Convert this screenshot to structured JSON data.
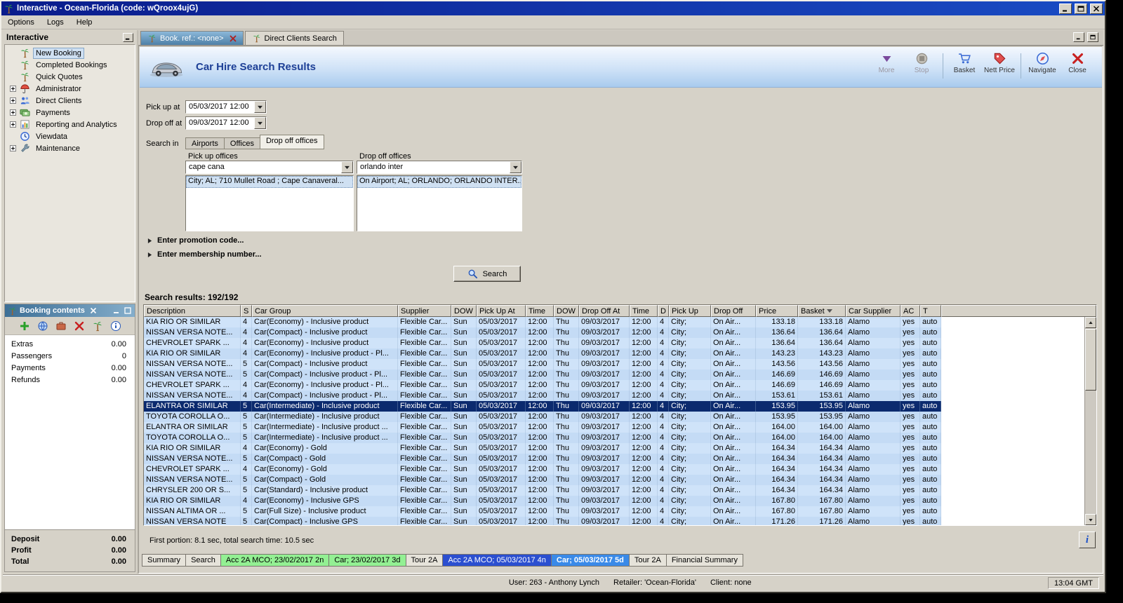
{
  "window": {
    "title": "Interactive - Ocean-Florida (code: wQroox4ujG)",
    "clock": "13:04 GMT",
    "status": {
      "user": "User: 263 - Anthony Lynch",
      "retailer": "Retailer: 'Ocean-Florida'",
      "client": "Client: none"
    }
  },
  "menu": {
    "items": [
      "Options",
      "Logs",
      "Help"
    ]
  },
  "sidebar": {
    "title": "Interactive",
    "items": [
      {
        "label": "New Booking",
        "icon": "palm-icon",
        "expandable": false,
        "selected": true
      },
      {
        "label": "Completed Bookings",
        "icon": "palm-icon",
        "expandable": false,
        "selected": false
      },
      {
        "label": "Quick Quotes",
        "icon": "palm-icon",
        "expandable": false,
        "selected": false
      },
      {
        "label": "Administrator",
        "icon": "umbrella-icon",
        "expandable": true,
        "selected": false
      },
      {
        "label": "Direct Clients",
        "icon": "clients-icon",
        "expandable": true,
        "selected": false
      },
      {
        "label": "Payments",
        "icon": "payments-icon",
        "expandable": true,
        "selected": false
      },
      {
        "label": "Reporting and Analytics",
        "icon": "report-icon",
        "expandable": true,
        "selected": false
      },
      {
        "label": "Viewdata",
        "icon": "clock-icon",
        "expandable": false,
        "selected": false
      },
      {
        "label": "Maintenance",
        "icon": "wrench-icon",
        "expandable": true,
        "selected": false
      }
    ]
  },
  "booking_contents": {
    "title": "Booking contents",
    "toolbar_icons": [
      "add-icon",
      "world-icon",
      "luggage-icon",
      "delete-icon",
      "palm-icon",
      "info-icon"
    ],
    "rows": [
      {
        "label": "Extras",
        "value": "0.00"
      },
      {
        "label": "Passengers",
        "value": "0"
      },
      {
        "label": "Payments",
        "value": "0.00"
      },
      {
        "label": "Refunds",
        "value": "0.00"
      }
    ],
    "totals": [
      {
        "label": "Deposit",
        "value": "0.00"
      },
      {
        "label": "Profit",
        "value": "0.00"
      },
      {
        "label": "Total",
        "value": "0.00"
      }
    ]
  },
  "mdi_tabs": [
    {
      "label": "Book. ref.: <none>",
      "icon": "palm-icon",
      "closable": true,
      "active": true
    },
    {
      "label": "Direct Clients Search",
      "icon": "palm-icon",
      "closable": false,
      "active": false
    }
  ],
  "page": {
    "title": "Car Hire Search Results",
    "icon": "car-icon",
    "toolbar": [
      {
        "label": "More",
        "icon": "more-icon",
        "disabled": true,
        "sep_after": false
      },
      {
        "label": "Stop",
        "icon": "stop-icon",
        "disabled": true,
        "sep_after": true
      },
      {
        "label": "Basket",
        "icon": "basket-icon",
        "disabled": false,
        "sep_after": false
      },
      {
        "label": "Nett Price",
        "icon": "nett-price-icon",
        "disabled": false,
        "sep_after": true
      },
      {
        "label": "Navigate",
        "icon": "navigate-icon",
        "disabled": false,
        "sep_after": false
      },
      {
        "label": "Close",
        "icon": "close-icon",
        "disabled": false,
        "sep_after": false
      }
    ]
  },
  "form": {
    "pickup_label": "Pick up at",
    "pickup_value": "05/03/2017 12:00",
    "dropoff_label": "Drop off at",
    "dropoff_value": "09/03/2017 12:00",
    "search_in_label": "Search in",
    "search_tabs": [
      "Airports",
      "Offices",
      "Drop off offices"
    ],
    "active_search_tab": 2,
    "pickup_offices_label": "Pick up offices",
    "pickup_offices_value": "cape cana",
    "pickup_offices_item": "City; AL; 710 Mullet Road ; Cape Canaveral...",
    "dropoff_offices_label": "Drop off offices",
    "dropoff_offices_value": "orlando inter",
    "dropoff_offices_item": "On Airport; AL; ORLANDO; ORLANDO INTER...",
    "promo_label": "Enter promotion code...",
    "membership_label": "Enter membership number...",
    "search_button": "Search"
  },
  "results": {
    "summary": "Search results: 192/192",
    "columns": [
      "Description",
      "S",
      "Car Group",
      "Supplier",
      "DOW",
      "Pick Up At",
      "Time",
      "DOW",
      "Drop Off At",
      "Time",
      "D",
      "Pick Up",
      "Drop Off",
      "Price",
      "Basket",
      "Car Supplier",
      "AC",
      "T"
    ],
    "sort_column": "Basket",
    "selected_row": 8,
    "footer": "First portion: 8.1 sec, total search time: 10.5 sec",
    "rows": [
      [
        "KIA RIO OR SIMILAR",
        "4",
        "Car(Economy) - Inclusive product",
        "Flexible Car...",
        "Sun",
        "05/03/2017",
        "12:00",
        "Thu",
        "09/03/2017",
        "12:00",
        "4",
        "City;",
        "On Air...",
        "133.18",
        "133.18",
        "Alamo",
        "yes",
        "auto"
      ],
      [
        "NISSAN VERSA NOTE...",
        "4",
        "Car(Compact) - Inclusive product",
        "Flexible Car...",
        "Sun",
        "05/03/2017",
        "12:00",
        "Thu",
        "09/03/2017",
        "12:00",
        "4",
        "City;",
        "On Air...",
        "136.64",
        "136.64",
        "Alamo",
        "yes",
        "auto"
      ],
      [
        "CHEVROLET SPARK ...",
        "4",
        "Car(Economy) - Inclusive product",
        "Flexible Car...",
        "Sun",
        "05/03/2017",
        "12:00",
        "Thu",
        "09/03/2017",
        "12:00",
        "4",
        "City;",
        "On Air...",
        "136.64",
        "136.64",
        "Alamo",
        "yes",
        "auto"
      ],
      [
        "KIA RIO OR SIMILAR",
        "4",
        "Car(Economy) - Inclusive product - Pl...",
        "Flexible Car...",
        "Sun",
        "05/03/2017",
        "12:00",
        "Thu",
        "09/03/2017",
        "12:00",
        "4",
        "City;",
        "On Air...",
        "143.23",
        "143.23",
        "Alamo",
        "yes",
        "auto"
      ],
      [
        "NISSAN VERSA NOTE...",
        "5",
        "Car(Compact) - Inclusive product",
        "Flexible Car...",
        "Sun",
        "05/03/2017",
        "12:00",
        "Thu",
        "09/03/2017",
        "12:00",
        "4",
        "City;",
        "On Air...",
        "143.56",
        "143.56",
        "Alamo",
        "yes",
        "auto"
      ],
      [
        "NISSAN VERSA NOTE...",
        "5",
        "Car(Compact) - Inclusive product - Pl...",
        "Flexible Car...",
        "Sun",
        "05/03/2017",
        "12:00",
        "Thu",
        "09/03/2017",
        "12:00",
        "4",
        "City;",
        "On Air...",
        "146.69",
        "146.69",
        "Alamo",
        "yes",
        "auto"
      ],
      [
        "CHEVROLET SPARK ...",
        "4",
        "Car(Economy) - Inclusive product - Pl...",
        "Flexible Car...",
        "Sun",
        "05/03/2017",
        "12:00",
        "Thu",
        "09/03/2017",
        "12:00",
        "4",
        "City;",
        "On Air...",
        "146.69",
        "146.69",
        "Alamo",
        "yes",
        "auto"
      ],
      [
        "NISSAN VERSA NOTE...",
        "4",
        "Car(Compact) - Inclusive product - Pl...",
        "Flexible Car...",
        "Sun",
        "05/03/2017",
        "12:00",
        "Thu",
        "09/03/2017",
        "12:00",
        "4",
        "City;",
        "On Air...",
        "153.61",
        "153.61",
        "Alamo",
        "yes",
        "auto"
      ],
      [
        "ELANTRA OR SIMILAR",
        "5",
        "Car(Intermediate) - Inclusive product",
        "Flexible Car...",
        "Sun",
        "05/03/2017",
        "12:00",
        "Thu",
        "09/03/2017",
        "12:00",
        "4",
        "City;",
        "On Air...",
        "153.95",
        "153.95",
        "Alamo",
        "yes",
        "auto"
      ],
      [
        "TOYOTA COROLLA O...",
        "5",
        "Car(Intermediate) - Inclusive product",
        "Flexible Car...",
        "Sun",
        "05/03/2017",
        "12:00",
        "Thu",
        "09/03/2017",
        "12:00",
        "4",
        "City;",
        "On Air...",
        "153.95",
        "153.95",
        "Alamo",
        "yes",
        "auto"
      ],
      [
        "ELANTRA OR SIMILAR",
        "5",
        "Car(Intermediate) - Inclusive product ...",
        "Flexible Car...",
        "Sun",
        "05/03/2017",
        "12:00",
        "Thu",
        "09/03/2017",
        "12:00",
        "4",
        "City;",
        "On Air...",
        "164.00",
        "164.00",
        "Alamo",
        "yes",
        "auto"
      ],
      [
        "TOYOTA COROLLA O...",
        "5",
        "Car(Intermediate) - Inclusive product ...",
        "Flexible Car...",
        "Sun",
        "05/03/2017",
        "12:00",
        "Thu",
        "09/03/2017",
        "12:00",
        "4",
        "City;",
        "On Air...",
        "164.00",
        "164.00",
        "Alamo",
        "yes",
        "auto"
      ],
      [
        "KIA RIO OR SIMILAR",
        "4",
        "Car(Economy) - Gold",
        "Flexible Car...",
        "Sun",
        "05/03/2017",
        "12:00",
        "Thu",
        "09/03/2017",
        "12:00",
        "4",
        "City;",
        "On Air...",
        "164.34",
        "164.34",
        "Alamo",
        "yes",
        "auto"
      ],
      [
        "NISSAN VERSA NOTE...",
        "5",
        "Car(Compact) - Gold",
        "Flexible Car...",
        "Sun",
        "05/03/2017",
        "12:00",
        "Thu",
        "09/03/2017",
        "12:00",
        "4",
        "City;",
        "On Air...",
        "164.34",
        "164.34",
        "Alamo",
        "yes",
        "auto"
      ],
      [
        "CHEVROLET SPARK ...",
        "4",
        "Car(Economy) - Gold",
        "Flexible Car...",
        "Sun",
        "05/03/2017",
        "12:00",
        "Thu",
        "09/03/2017",
        "12:00",
        "4",
        "City;",
        "On Air...",
        "164.34",
        "164.34",
        "Alamo",
        "yes",
        "auto"
      ],
      [
        "NISSAN VERSA NOTE...",
        "5",
        "Car(Compact) - Gold",
        "Flexible Car...",
        "Sun",
        "05/03/2017",
        "12:00",
        "Thu",
        "09/03/2017",
        "12:00",
        "4",
        "City;",
        "On Air...",
        "164.34",
        "164.34",
        "Alamo",
        "yes",
        "auto"
      ],
      [
        "CHRYSLER 200 OR S...",
        "5",
        "Car(Standard) - Inclusive product",
        "Flexible Car...",
        "Sun",
        "05/03/2017",
        "12:00",
        "Thu",
        "09/03/2017",
        "12:00",
        "4",
        "City;",
        "On Air...",
        "164.34",
        "164.34",
        "Alamo",
        "yes",
        "auto"
      ],
      [
        "KIA RIO OR SIMILAR",
        "4",
        "Car(Economy) - Inclusive GPS",
        "Flexible Car...",
        "Sun",
        "05/03/2017",
        "12:00",
        "Thu",
        "09/03/2017",
        "12:00",
        "4",
        "City;",
        "On Air...",
        "167.80",
        "167.80",
        "Alamo",
        "yes",
        "auto"
      ],
      [
        "NISSAN ALTIMA OR ...",
        "5",
        "Car(Full Size) - Inclusive product",
        "Flexible Car...",
        "Sun",
        "05/03/2017",
        "12:00",
        "Thu",
        "09/03/2017",
        "12:00",
        "4",
        "City;",
        "On Air...",
        "167.80",
        "167.80",
        "Alamo",
        "yes",
        "auto"
      ],
      [
        "NISSAN VERSA NOTE",
        "5",
        "Car(Compact) - Inclusive GPS",
        "Flexible Car...",
        "Sun",
        "05/03/2017",
        "12:00",
        "Thu",
        "09/03/2017",
        "12:00",
        "4",
        "City;",
        "On Air...",
        "171.26",
        "171.26",
        "Alamo",
        "yes",
        "auto"
      ]
    ]
  },
  "bottom_tabs": [
    {
      "label": "Summary",
      "style": "plain",
      "active": false
    },
    {
      "label": "Search",
      "style": "plain",
      "active": false
    },
    {
      "label": "Acc 2A MCO; 23/02/2017 2n",
      "style": "green",
      "active": false
    },
    {
      "label": "Car; 23/02/2017 3d",
      "style": "green",
      "active": false
    },
    {
      "label": "Tour 2A",
      "style": "plain",
      "active": false
    },
    {
      "label": "Acc 2A MCO; 05/03/2017 4n",
      "style": "blue",
      "active": false
    },
    {
      "label": "Car; 05/03/2017 5d",
      "style": "blue",
      "active": true
    },
    {
      "label": "Tour 2A",
      "style": "plain",
      "active": false
    },
    {
      "label": "Financial Summary",
      "style": "plain",
      "active": false
    }
  ]
}
